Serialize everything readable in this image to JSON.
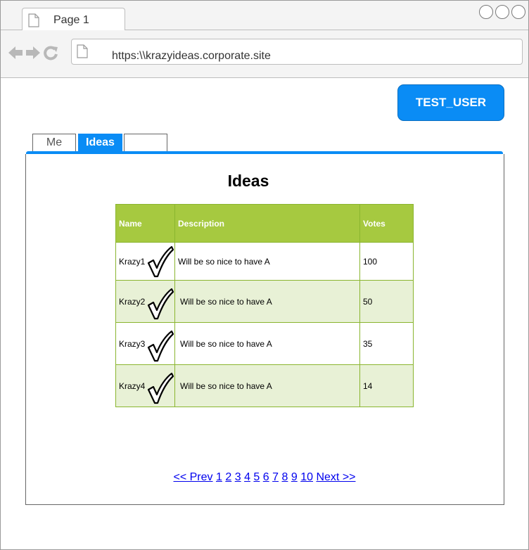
{
  "browser": {
    "tab_label": "Page 1",
    "url": "https:\\\\krazyideas.corporate.site"
  },
  "user_button": "TEST_USER",
  "tabs": [
    {
      "label": "Me",
      "active": false
    },
    {
      "label": "Ideas",
      "active": true
    },
    {
      "label": "",
      "active": false
    }
  ],
  "heading": "Ideas",
  "table": {
    "headers": [
      "Name",
      "Description",
      "Votes"
    ],
    "rows": [
      {
        "name": "Krazy1",
        "description": "Will be so nice to have A",
        "votes": "100",
        "checked": true
      },
      {
        "name": "Krazy2",
        "description": "Will be so nice to have A",
        "votes": "50",
        "checked": true
      },
      {
        "name": "Krazy3",
        "description": "Will be so nice to have A",
        "votes": "35",
        "checked": true
      },
      {
        "name": "Krazy4",
        "description": "Will be so nice to have A",
        "votes": "14",
        "checked": true
      }
    ]
  },
  "pagination": {
    "prev": "<< Prev",
    "pages": [
      "1",
      "2",
      "3",
      "4",
      "5",
      "6",
      "7",
      "8",
      "9",
      "10"
    ],
    "next": "Next >>"
  },
  "colors": {
    "accent": "#0a8cf5",
    "table_header": "#a6c940",
    "table_alt_row": "#e8f1d6",
    "link": "#0000ee"
  }
}
